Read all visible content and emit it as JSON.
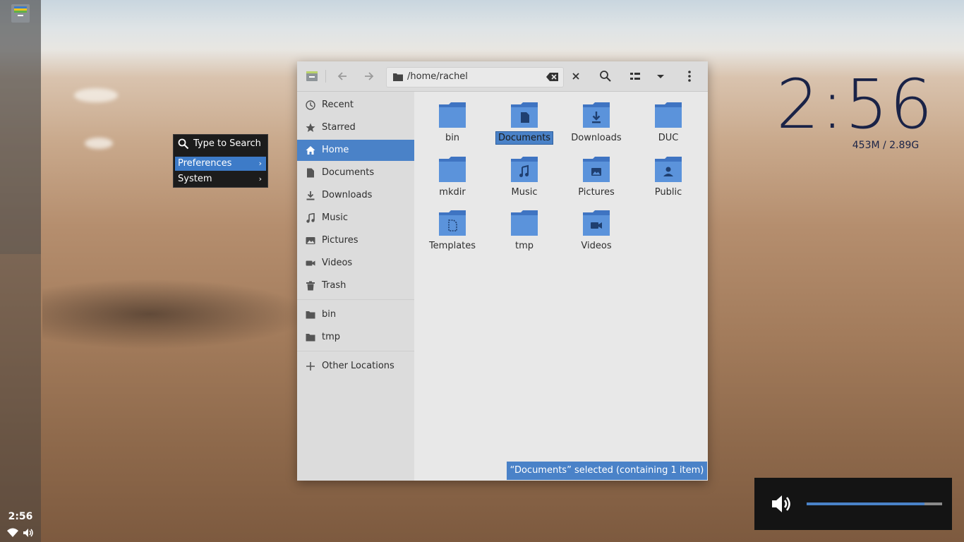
{
  "panel": {
    "clock": "2:56"
  },
  "context_menu": {
    "search_label": "Type to Search",
    "items": [
      {
        "label": "Preferences",
        "arrow": "›"
      },
      {
        "label": "System",
        "arrow": "›"
      }
    ]
  },
  "window": {
    "path": "/home/rachel",
    "sidebar": {
      "places": [
        "Recent",
        "Starred",
        "Home",
        "Documents",
        "Downloads",
        "Music",
        "Pictures",
        "Videos",
        "Trash"
      ],
      "bookmarks": [
        "bin",
        "tmp"
      ],
      "other": "Other Locations"
    },
    "files": [
      "bin",
      "Documents",
      "Downloads",
      "DUC",
      "mkdir",
      "Music",
      "Pictures",
      "Public",
      "Templates",
      "tmp",
      "Videos"
    ],
    "status": "“Documents” selected  (containing 1 item)"
  },
  "desktop": {
    "clock": "2:56",
    "memory": "453M / 2.89G"
  },
  "volume": {
    "level": 0.87
  },
  "colors": {
    "accent": "#4a82c8",
    "clock_text": "#1a2347"
  }
}
